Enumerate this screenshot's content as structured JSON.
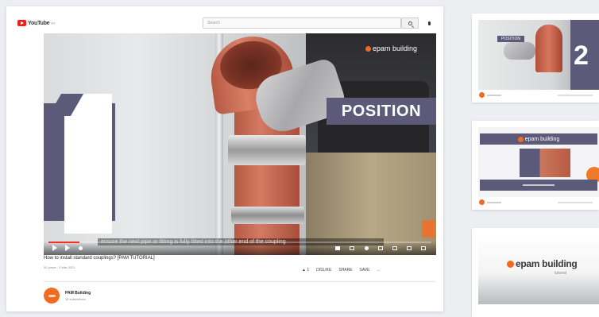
{
  "header": {
    "logo_text": "YouTube",
    "logo_sup": "PT",
    "search_placeholder": "Search"
  },
  "player": {
    "step_number": "1",
    "overlay_label": "POSITION",
    "brand_name": "epam building",
    "subtitle": "ensure the next pipe or fitting is fully fitted into the other end of the coupling",
    "progress": 0.08
  },
  "video": {
    "title": "How to install standard couplings? [PAM TUTORIAL]",
    "meta": "52 views · 3 Mar 2021",
    "like_label": "1",
    "actions": [
      "DISLIKE",
      "SHARE",
      "SAVE",
      "..."
    ]
  },
  "channel": {
    "name": "PAM Building",
    "subscribers": "16 subscribers"
  },
  "side": {
    "thumb1_label": "POSITION",
    "thumb1_number": "2",
    "thumb2_brand": "epam building",
    "thumb3_brand": "epam building",
    "thumb3_sub": "tutorial"
  },
  "colors": {
    "accent_purple": "#5c5a78",
    "brand_orange": "#f06a1f",
    "youtube_red": "#ff1a1a"
  }
}
